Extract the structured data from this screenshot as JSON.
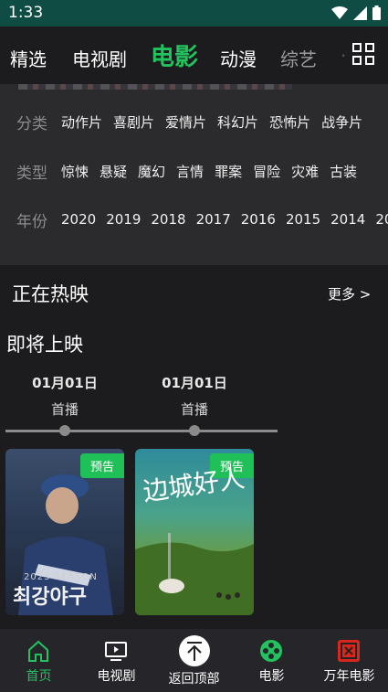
{
  "status": {
    "time": "1:33"
  },
  "nav": {
    "tabs": [
      "精选",
      "电视剧",
      "电影",
      "动漫",
      "综艺",
      "·"
    ],
    "active_index": 2
  },
  "filters": {
    "rows": [
      {
        "label": "分类",
        "options": [
          "动作片",
          "喜剧片",
          "爱情片",
          "科幻片",
          "恐怖片",
          "战争片"
        ]
      },
      {
        "label": "类型",
        "options": [
          "惊悚",
          "悬疑",
          "魔幻",
          "言情",
          "罪案",
          "冒险",
          "灾难",
          "古装"
        ]
      },
      {
        "label": "年份",
        "options": [
          "2020",
          "2019",
          "2018",
          "2017",
          "2016",
          "2015",
          "2014",
          "20"
        ]
      }
    ]
  },
  "now_showing": {
    "title": "正在热映",
    "more": "更多 >"
  },
  "coming_soon": {
    "title": "即将上映",
    "dates": [
      {
        "date": "01月01日",
        "label": "首播"
      },
      {
        "date": "01月01日",
        "label": "首播"
      }
    ],
    "posters": [
      {
        "badge": "预告",
        "season": "2023 SEASON",
        "text": "최강야구"
      },
      {
        "badge": "预告",
        "text": "边城好人"
      }
    ]
  },
  "bottom_nav": {
    "items": [
      "首页",
      "电视剧",
      "返回顶部",
      "电影",
      "万年电影"
    ],
    "active_index": 0
  },
  "colors": {
    "accent": "#22c35e",
    "status_bar": "#0f4c44",
    "background": "#1c1c1e"
  }
}
